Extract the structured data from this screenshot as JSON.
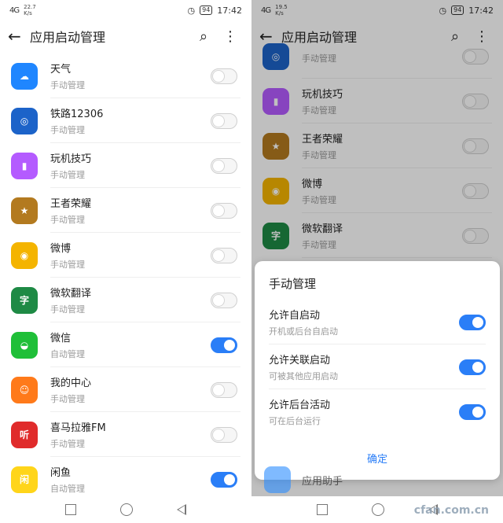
{
  "left": {
    "status": {
      "signal": "4G",
      "speed_value": "22.7",
      "speed_unit": "K/s",
      "battery": "94",
      "time": "17:42"
    },
    "title": "应用启动管理",
    "items": [
      {
        "name": "天气",
        "sub": "手动管理",
        "icon": "weather-icon",
        "color": "#1f86ff",
        "glyph": "☁",
        "on": false
      },
      {
        "name": "铁路12306",
        "sub": "手动管理",
        "icon": "railway-icon",
        "color": "#1c63c9",
        "glyph": "◎",
        "on": false
      },
      {
        "name": "玩机技巧",
        "sub": "手动管理",
        "icon": "tips-icon",
        "color": "#b45bff",
        "glyph": "▮",
        "on": false
      },
      {
        "name": "王者荣耀",
        "sub": "手动管理",
        "icon": "game-icon",
        "color": "#b37a1f",
        "glyph": "★",
        "on": false
      },
      {
        "name": "微博",
        "sub": "手动管理",
        "icon": "weibo-icon",
        "color": "#f4b400",
        "glyph": "◉",
        "on": false
      },
      {
        "name": "微软翻译",
        "sub": "手动管理",
        "icon": "translate-icon",
        "color": "#1e8a45",
        "glyph": "字",
        "on": false
      },
      {
        "name": "微信",
        "sub": "自动管理",
        "icon": "wechat-icon",
        "color": "#1fbf38",
        "glyph": "◒",
        "on": true
      },
      {
        "name": "我的中心",
        "sub": "手动管理",
        "icon": "my-center-icon",
        "color": "#ff7a1a",
        "glyph": "☺",
        "on": false
      },
      {
        "name": "喜马拉雅FM",
        "sub": "手动管理",
        "icon": "ximalaya-icon",
        "color": "#e02b2b",
        "glyph": "听",
        "on": false
      },
      {
        "name": "闲鱼",
        "sub": "自动管理",
        "icon": "xianyu-icon",
        "color": "#ffd51a",
        "glyph": "闲",
        "on": true
      }
    ]
  },
  "right": {
    "status": {
      "signal": "4G",
      "speed_value": "19.5",
      "speed_unit": "K/s",
      "battery": "94",
      "time": "17:42"
    },
    "title": "应用启动管理",
    "items": [
      {
        "name": "",
        "sub": "手动管理",
        "icon": "railway-icon",
        "color": "#1c63c9",
        "glyph": "◎",
        "on": false
      },
      {
        "name": "玩机技巧",
        "sub": "手动管理",
        "icon": "tips-icon",
        "color": "#b45bff",
        "glyph": "▮",
        "on": false
      },
      {
        "name": "王者荣耀",
        "sub": "手动管理",
        "icon": "game-icon",
        "color": "#b37a1f",
        "glyph": "★",
        "on": false
      },
      {
        "name": "微博",
        "sub": "手动管理",
        "icon": "weibo-icon",
        "color": "#f4b400",
        "glyph": "◉",
        "on": false
      },
      {
        "name": "微软翻译",
        "sub": "手动管理",
        "icon": "translate-icon",
        "color": "#1e8a45",
        "glyph": "字",
        "on": false
      }
    ],
    "dialog": {
      "title": "手动管理",
      "options": [
        {
          "label": "允许自启动",
          "desc": "开机或后台自启动",
          "on": true
        },
        {
          "label": "允许关联启动",
          "desc": "可被其他应用启动",
          "on": true
        },
        {
          "label": "允许后台活动",
          "desc": "可在后台运行",
          "on": true
        }
      ],
      "confirm": "确定"
    },
    "bottom_hint": "应用助手",
    "watermark": "cfan.com.cn"
  }
}
